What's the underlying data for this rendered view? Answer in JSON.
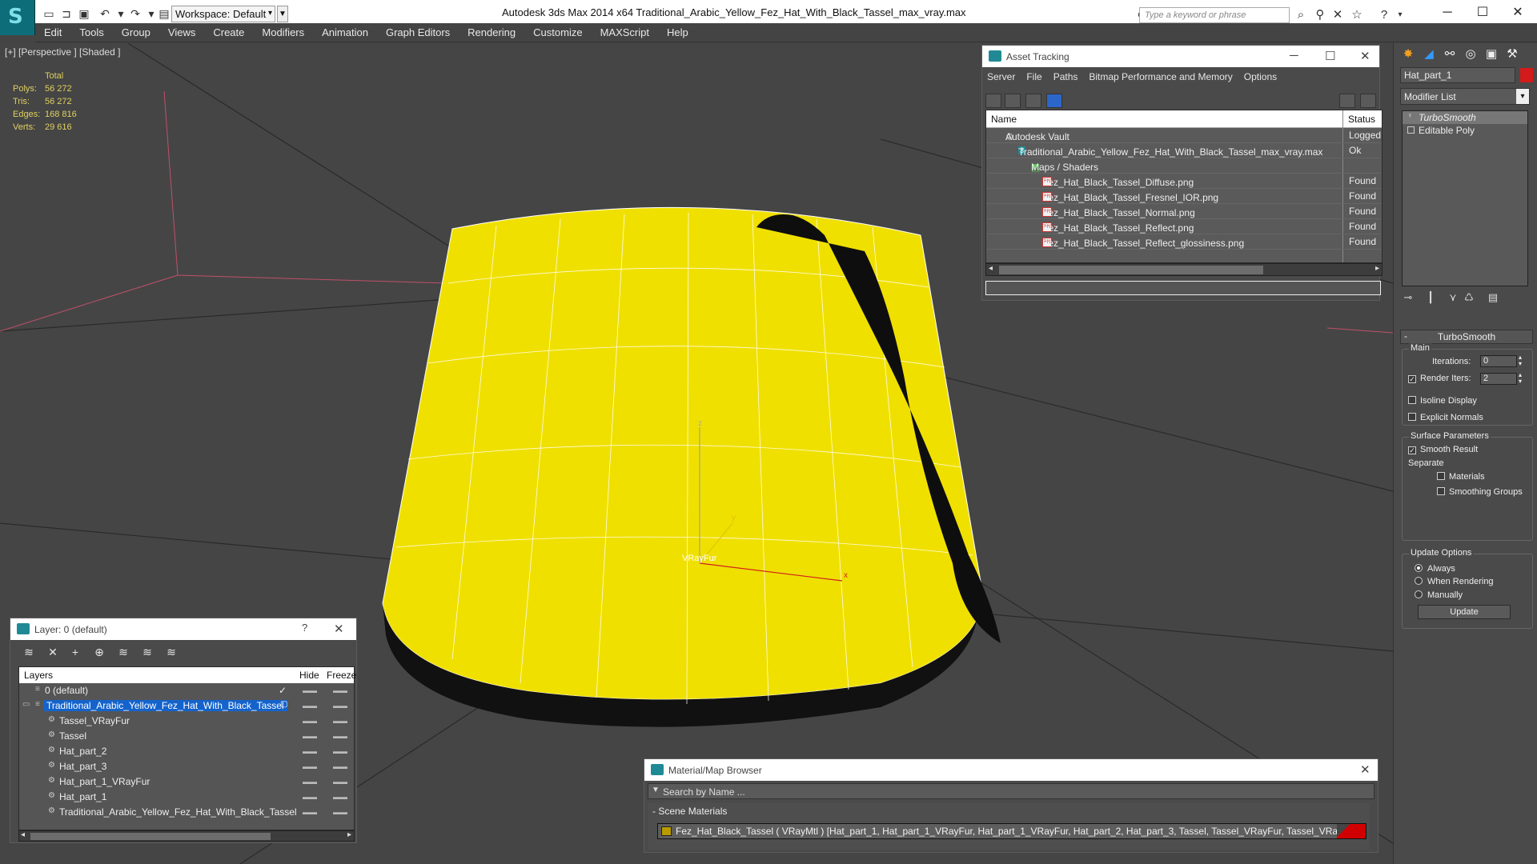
{
  "app": {
    "title": "Autodesk 3ds Max  2014 x64    Traditional_Arabic_Yellow_Fez_Hat_With_Black_Tassel_max_vray.max",
    "workspace": "Workspace: Default",
    "search_placeholder": "Type a keyword or phrase"
  },
  "menu": [
    "Edit",
    "Tools",
    "Group",
    "Views",
    "Create",
    "Modifiers",
    "Animation",
    "Graph Editors",
    "Rendering",
    "Customize",
    "MAXScript",
    "Help"
  ],
  "viewport": {
    "label": "[+] [Perspective ] [Shaded ]",
    "stats": {
      "header": "Total",
      "rows": [
        {
          "label": "Polys:",
          "value": "56 272"
        },
        {
          "label": "Tris:",
          "value": "56 272"
        },
        {
          "label": "Edges:",
          "value": "168 816"
        },
        {
          "label": "Verts:",
          "value": "29 616"
        }
      ]
    },
    "object_label": "VRayFur",
    "axis_x": "x",
    "axis_y": "y",
    "axis_z": "z",
    "colors": {
      "hat": "#f0e000",
      "band": "#111111",
      "wire": "#ffffff"
    }
  },
  "asset_tracking": {
    "title": "Asset Tracking",
    "menu": [
      "Server",
      "File",
      "Paths",
      "Bitmap Performance and Memory",
      "Options"
    ],
    "col_name": "Name",
    "col_status": "Status",
    "rows": [
      {
        "name": "Autodesk Vault",
        "status": "Logged",
        "indent": 0
      },
      {
        "name": "Traditional_Arabic_Yellow_Fez_Hat_With_Black_Tassel_max_vray.max",
        "status": "Ok",
        "indent": 1
      },
      {
        "name": "Maps / Shaders",
        "status": "",
        "indent": 2
      },
      {
        "name": "Fez_Hat_Black_Tassel_Diffuse.png",
        "status": "Found",
        "indent": 3
      },
      {
        "name": "Fez_Hat_Black_Tassel_Fresnel_IOR.png",
        "status": "Found",
        "indent": 3
      },
      {
        "name": "Fez_Hat_Black_Tassel_Normal.png",
        "status": "Found",
        "indent": 3
      },
      {
        "name": "Fez_Hat_Black_Tassel_Reflect.png",
        "status": "Found",
        "indent": 3
      },
      {
        "name": "Fez_Hat_Black_Tassel_Reflect_glossiness.png",
        "status": "Found",
        "indent": 3
      }
    ],
    "png_badge": "PNG"
  },
  "layer_panel": {
    "title": "Layer: 0 (default)",
    "help": "?",
    "col_layers": "Layers",
    "col_hide": "Hide",
    "col_freeze": "Freeze",
    "rows": [
      {
        "name": "0 (default)",
        "indent": 0,
        "selected": false
      },
      {
        "name": "Traditional_Arabic_Yellow_Fez_Hat_With_Black_Tassel",
        "indent": 0,
        "selected": true
      },
      {
        "name": "Tassel_VRayFur",
        "indent": 1,
        "selected": false
      },
      {
        "name": "Tassel",
        "indent": 1,
        "selected": false
      },
      {
        "name": "Hat_part_2",
        "indent": 1,
        "selected": false
      },
      {
        "name": "Hat_part_3",
        "indent": 1,
        "selected": false
      },
      {
        "name": "Hat_part_1_VRayFur",
        "indent": 1,
        "selected": false
      },
      {
        "name": "Hat_part_1",
        "indent": 1,
        "selected": false
      },
      {
        "name": "Traditional_Arabic_Yellow_Fez_Hat_With_Black_Tassel",
        "indent": 1,
        "selected": false
      }
    ]
  },
  "material_browser": {
    "title": "Material/Map Browser",
    "search_placeholder": "Search by Name ...",
    "group": "- Scene Materials",
    "item": "Fez_Hat_Black_Tassel  ( VRayMtl ) [Hat_part_1, Hat_part_1_VRayFur, Hat_part_1_VRayFur, Hat_part_2, Hat_part_3, Tassel, Tassel_VRayFur, Tassel_VRayFur]"
  },
  "command_panel": {
    "object_name": "Hat_part_1",
    "modifier_list": "Modifier List",
    "stack": [
      "TurboSmooth",
      "Editable Poly"
    ],
    "rollout": "TurboSmooth",
    "main": "Main",
    "iterations_label": "Iterations:",
    "iterations": "0",
    "render_iters_label": "Render Iters:",
    "render_iters": "2",
    "isoline": "Isoline Display",
    "explicit": "Explicit Normals",
    "surface": "Surface Parameters",
    "smooth": "Smooth Result",
    "separate": "Separate",
    "materials": "Materials",
    "smoothing": "Smoothing Groups",
    "update_options": "Update Options",
    "always": "Always",
    "when_rendering": "When Rendering",
    "manually": "Manually",
    "update": "Update"
  }
}
